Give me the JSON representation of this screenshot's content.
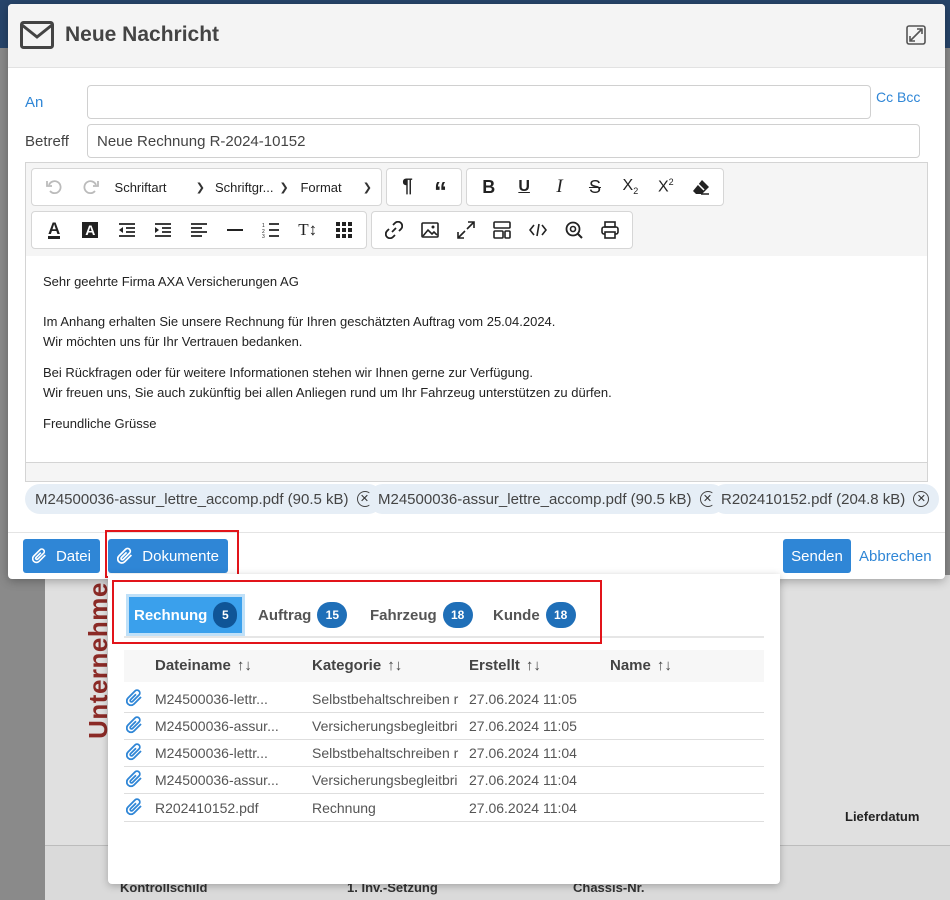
{
  "background": {
    "vertical_text": "Unternehme",
    "lieferdatum": "Lieferdatum",
    "cells": [
      "Kontrollschild",
      "1. Inv.-Setzung",
      "Chassis-Nr."
    ]
  },
  "modal": {
    "title": "Neue Nachricht",
    "to_label": "An",
    "to_value": "",
    "cc_bcc": "Cc Bcc",
    "subject_label": "Betreff",
    "subject_value": "Neue Rechnung R-2024-10152",
    "toolbar": {
      "font": "Schriftart",
      "size": "Schriftgr...",
      "format": "Format"
    },
    "body": {
      "greeting": "Sehr geehrte Firma AXA Versicherungen AG",
      "p1_line1": "Im Anhang erhalten Sie unsere Rechnung für Ihren geschätzten Auftrag vom 25.04.2024.",
      "p1_line2": "Wir möchten uns für Ihr Vertrauen bedanken.",
      "p2_line1": "Bei Rückfragen oder für weitere Informationen stehen wir Ihnen  gerne zur Verfügung.",
      "p2_line2": "Wir freuen uns, Sie auch zukünftig bei allen Anliegen rund um Ihr Fahrzeug unterstützen zu dürfen.",
      "closing": "Freundliche Grüsse"
    },
    "attachments": [
      {
        "label": "M24500036-assur_lettre_accomp.pdf (90.5 kB)"
      },
      {
        "label": "M24500036-assur_lettre_accomp.pdf (90.5 kB)"
      },
      {
        "label": "R202410152.pdf (204.8 kB)"
      }
    ],
    "buttons": {
      "datei": "Datei",
      "dokumente": "Dokumente",
      "senden": "Senden",
      "abbrechen": "Abbrechen"
    }
  },
  "documents": {
    "tabs": [
      {
        "label": "Rechnung",
        "count": "5"
      },
      {
        "label": "Auftrag",
        "count": "15"
      },
      {
        "label": "Fahrzeug",
        "count": "18"
      },
      {
        "label": "Kunde",
        "count": "18"
      }
    ],
    "columns": [
      "Dateiname",
      "Kategorie",
      "Erstellt",
      "Name"
    ],
    "sort_glyph": "↑↓",
    "rows": [
      {
        "file": "M24500036-lettr...",
        "category": "Selbstbehaltschreiben r",
        "created": "27.06.2024 11:05",
        "name": ""
      },
      {
        "file": "M24500036-assur...",
        "category": "Versicherungsbegleitbri",
        "created": "27.06.2024 11:05",
        "name": ""
      },
      {
        "file": "M24500036-lettr...",
        "category": "Selbstbehaltschreiben r",
        "created": "27.06.2024 11:04",
        "name": ""
      },
      {
        "file": "M24500036-assur...",
        "category": "Versicherungsbegleitbri",
        "created": "27.06.2024 11:04",
        "name": ""
      },
      {
        "file": "R202410152.pdf",
        "category": "Rechnung",
        "created": "27.06.2024 11:04",
        "name": ""
      }
    ]
  },
  "colors": {
    "accent": "#2f86d6",
    "highlight": "#e2141a",
    "active_tab": "#3aa0ec"
  }
}
